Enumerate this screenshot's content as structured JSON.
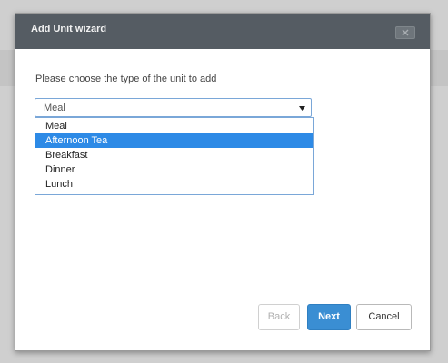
{
  "dialog": {
    "title": "Add Unit wizard",
    "prompt": "Please choose the type of the unit to add"
  },
  "select": {
    "selected_value": "Meal",
    "options": [
      "Meal",
      "Afternoon Tea",
      "Breakfast",
      "Dinner",
      "Lunch"
    ],
    "highlighted_option": "Afternoon Tea"
  },
  "buttons": {
    "back_label": "Back",
    "next_label": "Next",
    "cancel_label": "Cancel"
  },
  "colors": {
    "header_bg": "#555c63",
    "highlight": "#2d8ae6",
    "primary_button": "#3a8ed3"
  },
  "icons": {
    "close": "close-icon",
    "dropdown_arrow": "caret-down-icon"
  }
}
